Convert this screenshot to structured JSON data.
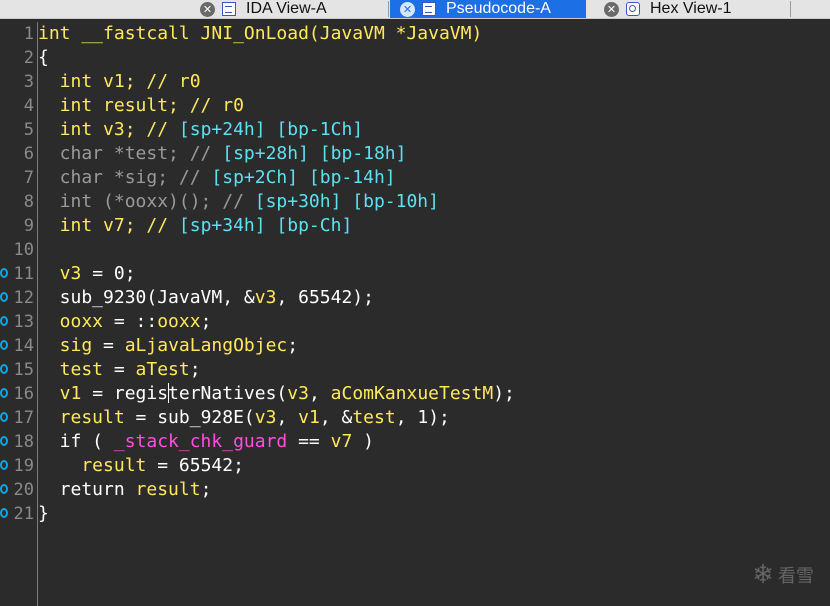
{
  "tabs": [
    {
      "label": "IDA View-A",
      "active": false,
      "icon": "doc-icon"
    },
    {
      "label": "Pseudocode-A",
      "active": true,
      "icon": "doc-icon"
    },
    {
      "label": "Hex View-1",
      "active": false,
      "icon": "hex-icon"
    }
  ],
  "colors": {
    "background": "#2b2b2b",
    "active_tab": "#1d6fe6",
    "keyword_yellow": "#ffe95a",
    "comment_cyan": "#5ce1f2",
    "breakpoint": "#11a6e0",
    "guard_magenta": "#ff4fe0"
  },
  "code_lines": [
    {
      "n": "1",
      "bp": false,
      "tokens": [
        [
          "kw",
          "int __fastcall JNI_OnLoad(JavaVM *JavaVM)"
        ]
      ]
    },
    {
      "n": "2",
      "bp": false,
      "tokens": [
        [
          "id",
          "{"
        ]
      ]
    },
    {
      "n": "3",
      "bp": false,
      "tokens": [
        [
          "kw",
          "  int v1; // "
        ],
        [
          "kw",
          "r0"
        ]
      ]
    },
    {
      "n": "4",
      "bp": false,
      "tokens": [
        [
          "kw",
          "  int result; // "
        ],
        [
          "kw",
          "r0"
        ]
      ]
    },
    {
      "n": "5",
      "bp": false,
      "tokens": [
        [
          "kw",
          "  int v3; // "
        ],
        [
          "reg",
          "[sp+24h] [bp-1Ch]"
        ]
      ]
    },
    {
      "n": "6",
      "bp": false,
      "tokens": [
        [
          "typ",
          "  char *test; // "
        ],
        [
          "reg",
          "[sp+28h] [bp-18h]"
        ]
      ]
    },
    {
      "n": "7",
      "bp": false,
      "tokens": [
        [
          "typ",
          "  char *sig; // "
        ],
        [
          "reg",
          "[sp+2Ch] [bp-14h]"
        ]
      ]
    },
    {
      "n": "8",
      "bp": false,
      "tokens": [
        [
          "typ",
          "  int (*ooxx)(); // "
        ],
        [
          "reg",
          "[sp+30h] [bp-10h]"
        ]
      ]
    },
    {
      "n": "9",
      "bp": false,
      "tokens": [
        [
          "kw",
          "  int v7; // "
        ],
        [
          "reg",
          "[sp+34h] [bp-Ch]"
        ]
      ]
    },
    {
      "n": "10",
      "bp": false,
      "tokens": [
        [
          "id",
          ""
        ]
      ]
    },
    {
      "n": "11",
      "bp": true,
      "tokens": [
        [
          "kw",
          "  v3 "
        ],
        [
          "id",
          "= 0;"
        ]
      ]
    },
    {
      "n": "12",
      "bp": true,
      "tokens": [
        [
          "id",
          "  sub_9230(JavaVM, &"
        ],
        [
          "kw",
          "v3"
        ],
        [
          "id",
          ", 65542);"
        ]
      ]
    },
    {
      "n": "13",
      "bp": true,
      "tokens": [
        [
          "kw",
          "  ooxx "
        ],
        [
          "id",
          "= ::"
        ],
        [
          "kw",
          "ooxx"
        ],
        [
          "id",
          ";"
        ]
      ]
    },
    {
      "n": "14",
      "bp": true,
      "tokens": [
        [
          "kw",
          "  sig "
        ],
        [
          "id",
          "= "
        ],
        [
          "kw",
          "aLjavaLangObjec"
        ],
        [
          "id",
          ";"
        ]
      ]
    },
    {
      "n": "15",
      "bp": true,
      "tokens": [
        [
          "kw",
          "  test "
        ],
        [
          "id",
          "= "
        ],
        [
          "kw",
          "aTest"
        ],
        [
          "id",
          ";"
        ]
      ]
    },
    {
      "n": "16",
      "bp": true,
      "tokens": [
        [
          "kw",
          "  v1 "
        ],
        [
          "id",
          "= regis"
        ],
        [
          "cursor",
          ""
        ],
        [
          "id",
          "terNatives("
        ],
        [
          "kw",
          "v3"
        ],
        [
          "id",
          ", "
        ],
        [
          "kw",
          "aComKanxueTestM"
        ],
        [
          "id",
          ");"
        ]
      ]
    },
    {
      "n": "17",
      "bp": true,
      "tokens": [
        [
          "kw",
          "  result "
        ],
        [
          "id",
          "= sub_928E("
        ],
        [
          "kw",
          "v3"
        ],
        [
          "id",
          ", "
        ],
        [
          "kw",
          "v1"
        ],
        [
          "id",
          ", &"
        ],
        [
          "kw",
          "test"
        ],
        [
          "id",
          ", 1);"
        ]
      ]
    },
    {
      "n": "18",
      "bp": true,
      "tokens": [
        [
          "id",
          "  if ( "
        ],
        [
          "mag",
          "_stack_chk_guard"
        ],
        [
          "id",
          " == "
        ],
        [
          "kw",
          "v7"
        ],
        [
          "id",
          " )"
        ]
      ]
    },
    {
      "n": "19",
      "bp": true,
      "tokens": [
        [
          "kw",
          "    result "
        ],
        [
          "id",
          "= 65542;"
        ]
      ]
    },
    {
      "n": "20",
      "bp": true,
      "tokens": [
        [
          "id",
          "  return "
        ],
        [
          "kw",
          "result"
        ],
        [
          "id",
          ";"
        ]
      ]
    },
    {
      "n": "21",
      "bp": true,
      "tokens": [
        [
          "id",
          "}"
        ]
      ]
    }
  ],
  "watermark": {
    "text": "看雪",
    "icon": "snowflake-icon"
  }
}
